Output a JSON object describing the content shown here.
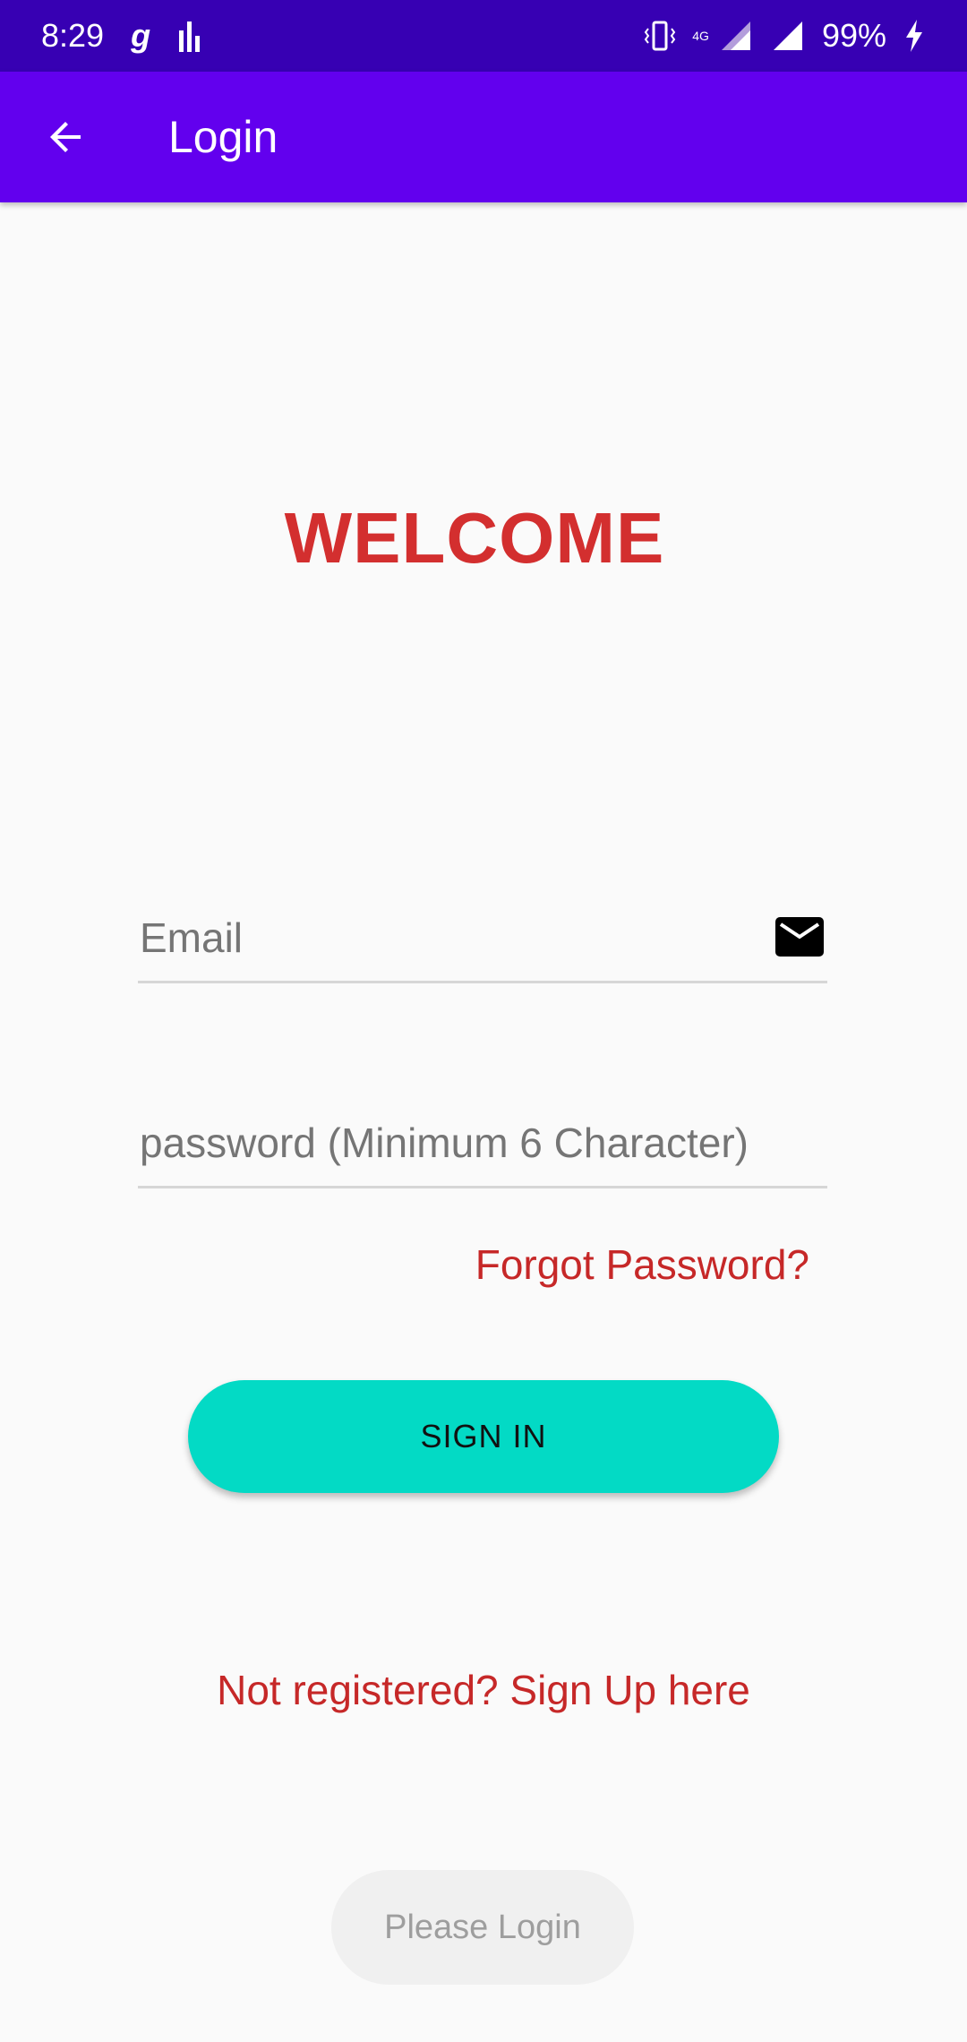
{
  "status_bar": {
    "time": "8:29",
    "battery": "99%",
    "network": "4G"
  },
  "app_bar": {
    "title": "Login"
  },
  "welcome": "WELCOME",
  "email": {
    "placeholder": "Email",
    "value": ""
  },
  "password": {
    "placeholder": "password (Minimum 6 Character)",
    "value": ""
  },
  "forgot_password": "Forgot Password?",
  "sign_in_label": "SIGN IN",
  "sign_up_link": "Not registered? Sign Up here",
  "toast": "Please Login",
  "colors": {
    "status_bar": "#3700b3",
    "app_bar": "#6200ee",
    "accent": "#03dac5",
    "text_red": "#d32f2f"
  },
  "icons": [
    "back-arrow-icon",
    "mail-icon",
    "vibrate-icon",
    "signal-icon",
    "battery-charging-icon"
  ]
}
